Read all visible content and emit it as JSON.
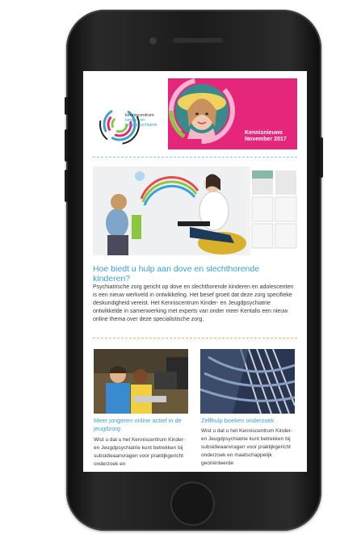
{
  "newsletter": {
    "logo": {
      "line1": "kenniscentrum",
      "line2": "kinder- en",
      "line3": "jeugdpsychiatrie"
    },
    "badge": {
      "title_line1": "Kennisnieuws",
      "title_line2": "November 2017"
    },
    "article": {
      "headline": "Hoe biedt u hulp aan dove en slechthorende kinderen?",
      "body": "Psychiatrische zorg gericht op dove en slechthorende kinderen en adolescenten is een nieuw werkveld in ontwikkeling. Het besef groeit dat deze zorg specifieke deskundigheid vereist. Het Kenniscentrum Kinder- en Jeugdpsychiatrie ontwikkelde in samenwerking met experts van onder meer Kentalis een nieuw online thema over deze specialistische zorg."
    },
    "cards": [
      {
        "title": "Meer jongeren online actief in de jeugdzorg",
        "text": "Wist u dat u het Kenniscentrum Kinder- en Jeugdpsychiatrie kunt betrekken bij subsidieaanvragen voor praktijkgericht onderzoek en"
      },
      {
        "title": "Zelfhulp boeken onderzoek",
        "text": "Wist u dat u het Kenniscentrum Kinder- en Jeugdpsychiatrie kunt betrekken bij subsidieaanvragen voor praktijkgericht onderzoek en maatschappelijk georiënteerde"
      }
    ]
  },
  "colors": {
    "brand_pink": "#e6267a",
    "brand_blue": "#3aa0d8",
    "phone_body": "#1b1b1b"
  }
}
